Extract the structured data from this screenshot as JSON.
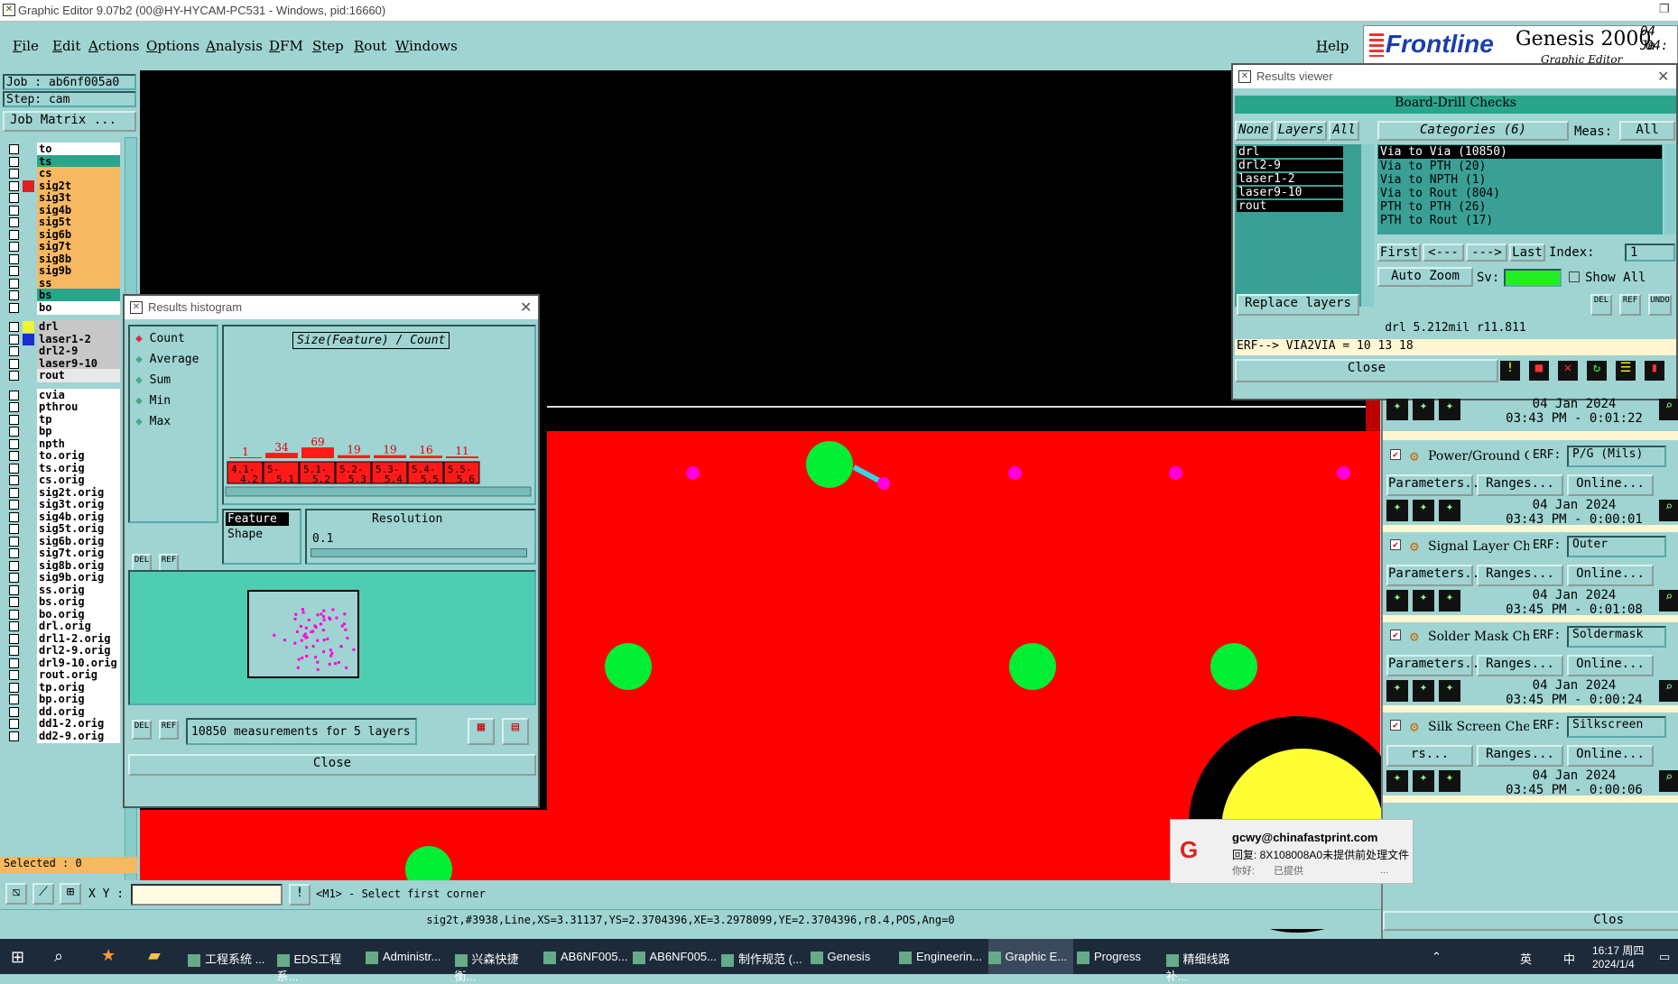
{
  "titlebar": {
    "title": "Graphic Editor 9.07b2 (00@HY-HYCAM-PC531 - Windows, pid:16660)"
  },
  "menu": {
    "items": [
      "File",
      "Edit",
      "Actions",
      "Options",
      "Analysis",
      "DFM",
      "Step",
      "Rout",
      "Windows"
    ],
    "help": "Help"
  },
  "brand": {
    "logo": "Frontline",
    "product": "Genesis 2000",
    "subtitle": "Graphic Editor",
    "date1": "04 Ja",
    "date2": "04:"
  },
  "job": {
    "job": "Job : ab6nf005a0",
    "step": "Step: cam",
    "matrix": "Job Matrix ..."
  },
  "layers": [
    {
      "name": "to",
      "color": "#ffffff"
    },
    {
      "name": "ts",
      "color": "#2aa58c"
    },
    {
      "name": "cs",
      "color": "#f6b860"
    },
    {
      "name": "sig2t",
      "color": "#f6b860",
      "swatch": "#e02020"
    },
    {
      "name": "sig3t",
      "color": "#f6b860"
    },
    {
      "name": "sig4b",
      "color": "#f6b860"
    },
    {
      "name": "sig5t",
      "color": "#f6b860"
    },
    {
      "name": "sig6b",
      "color": "#f6b860"
    },
    {
      "name": "sig7t",
      "color": "#f6b860"
    },
    {
      "name": "sig8b",
      "color": "#f6b860"
    },
    {
      "name": "sig9b",
      "color": "#f6b860"
    },
    {
      "name": "ss",
      "color": "#f6b860"
    },
    {
      "name": "bs",
      "color": "#2aa58c"
    },
    {
      "name": "bo",
      "color": "#ffffff"
    },
    {
      "name": "drl",
      "color": "#c8c8c8",
      "swatch": "#f2f23a"
    },
    {
      "name": "laser1-2",
      "color": "#c8c8c8",
      "swatch": "#1d2bd0"
    },
    {
      "name": "drl2-9",
      "color": "#c8c8c8"
    },
    {
      "name": "laser9-10",
      "color": "#c8c8c8"
    },
    {
      "name": "rout",
      "color": "#e8e8e8"
    },
    {
      "name": "cvia",
      "color": "#ffffff"
    },
    {
      "name": "pthrou",
      "color": "#ffffff"
    },
    {
      "name": "tp",
      "color": "#ffffff"
    },
    {
      "name": "bp",
      "color": "#ffffff"
    },
    {
      "name": "npth",
      "color": "#ffffff"
    },
    {
      "name": "to.orig",
      "color": "#ffffff"
    },
    {
      "name": "ts.orig",
      "color": "#ffffff"
    },
    {
      "name": "cs.orig",
      "color": "#ffffff"
    },
    {
      "name": "sig2t.orig",
      "color": "#ffffff"
    },
    {
      "name": "sig3t.orig",
      "color": "#ffffff"
    },
    {
      "name": "sig4b.orig",
      "color": "#ffffff"
    },
    {
      "name": "sig5t.orig",
      "color": "#ffffff"
    },
    {
      "name": "sig6b.orig",
      "color": "#ffffff"
    },
    {
      "name": "sig7t.orig",
      "color": "#ffffff"
    },
    {
      "name": "sig8b.orig",
      "color": "#ffffff"
    },
    {
      "name": "sig9b.orig",
      "color": "#ffffff"
    },
    {
      "name": "ss.orig",
      "color": "#ffffff"
    },
    {
      "name": "bs.orig",
      "color": "#ffffff"
    },
    {
      "name": "bo.orig",
      "color": "#ffffff"
    },
    {
      "name": "drl.orig",
      "color": "#ffffff"
    },
    {
      "name": "drl1-2.orig",
      "color": "#ffffff"
    },
    {
      "name": "drl2-9.orig",
      "color": "#ffffff"
    },
    {
      "name": "drl9-10.orig",
      "color": "#ffffff"
    },
    {
      "name": "rout.orig",
      "color": "#ffffff"
    },
    {
      "name": "tp.orig",
      "color": "#ffffff"
    },
    {
      "name": "bp.orig",
      "color": "#ffffff"
    },
    {
      "name": "dd.orig",
      "color": "#ffffff"
    },
    {
      "name": "dd1-2.orig",
      "color": "#ffffff"
    },
    {
      "name": "dd2-9.orig",
      "color": "#ffffff"
    }
  ],
  "selected": "Selected : 0",
  "command": {
    "xy_label": "X Y :",
    "prompt": "<M1> - Select first corner"
  },
  "status": "sig2t,#3938,Line,XS=3.31137,YS=2.3704396,XE=3.2978099,YE=2.3704396,r8.4,POS,Ang=0",
  "histogram": {
    "title": "Results histogram",
    "modes": [
      "Count",
      "Average",
      "Sum",
      "Min",
      "Max"
    ],
    "selected_mode": "Count",
    "chart_title": "Size(Feature) / Count",
    "counts": [
      "1",
      "34",
      "69",
      "19",
      "19",
      "16",
      "11"
    ],
    "bins": [
      "4.1-\n4.2",
      "5-\n5.1",
      "5.1-\n5.2",
      "5.2-\n5.3",
      "5.3-\n5.4",
      "5.4-\n5.5",
      "5.5-\n5.6"
    ],
    "feature_label": "Feature",
    "shape_label": "Shape",
    "resolution_label": "Resolution",
    "resolution_value": "0.1",
    "measurements": "10850 measurements for 5 layers",
    "close": "Close",
    "del": "DEL",
    "ref": "REF"
  },
  "results": {
    "title": "Results viewer",
    "header": "Board-Drill Checks",
    "none": "None",
    "layers_btn": "Layers",
    "all": "All",
    "categories_btn": "Categories (6)",
    "meas_label": "Meas:",
    "meas_value": "All",
    "layers": [
      "drl",
      "drl2-9",
      "laser1-2",
      "laser9-10",
      "rout"
    ],
    "categories": [
      "Via to Via  (10850)",
      "Via to PTH  (20)",
      "Via to NPTH  (1)",
      "Via to Rout  (804)",
      "PTH to PTH  (26)",
      "PTH to Rout  (17)"
    ],
    "first": "First",
    "prev": "<---",
    "next": "--->",
    "last": "Last",
    "index_label": "Index:",
    "index_value": "1",
    "auto_zoom": "Auto Zoom",
    "sv": "Sv:",
    "show_all": "Show All",
    "replace_layers": "Replace layers",
    "info": "drl 5.212mil  r11.811",
    "erf": "ERF--> VIA2VIA = 10 13 18",
    "close": "Close",
    "del": "DEL",
    "ref": "REF",
    "undo": "UNDO"
  },
  "checks": [
    {
      "date": "04 Jan 2024",
      "time": "03:43 PM - 0:01:22"
    },
    {
      "title": "Power/Ground C",
      "erf": "ERF:",
      "erf_value": "P/G (Mils)",
      "params": "Parameters...",
      "ranges": "Ranges...",
      "online": "Online...",
      "date": "04 Jan 2024",
      "time": "03:43 PM - 0:00:01"
    },
    {
      "title": "Signal Layer Ch",
      "erf": "ERF:",
      "erf_value": "Outer",
      "params": "Parameters...",
      "ranges": "Ranges...",
      "online": "Online...",
      "date": "04 Jan 2024",
      "time": "03:45 PM - 0:01:08"
    },
    {
      "title": "Solder Mask Ch",
      "erf": "ERF:",
      "erf_value": "Soldermask",
      "params": "Parameters...",
      "ranges": "Ranges...",
      "online": "Online...",
      "date": "04 Jan 2024",
      "time": "03:45 PM - 0:00:24"
    },
    {
      "title": "Silk Screen Che",
      "erf": "ERF:",
      "erf_value": "Silkscreen",
      "params": "rs...",
      "ranges": "Ranges...",
      "online": "Online...",
      "date": "04 Jan 2024",
      "time": "03:45 PM - 0:00:06"
    }
  ],
  "checks_close": "Clos",
  "notification": {
    "sender": "gcwy@chinafastprint.com",
    "line1": "回复: 8X108008A0未提供前处理文件",
    "line2": "你好:",
    "line3": "已提供",
    "more": "..."
  },
  "taskbar": {
    "apps": [
      "工程系统 ...",
      "EDS工程系...",
      "Administr...",
      "兴森快捷衡...",
      "AB6NF005...",
      "AB6NF005...",
      "制作规范 (...",
      "Genesis",
      "Engineerin...",
      "Graphic E...",
      "Progress",
      "精细线路补..."
    ],
    "ime": "中",
    "lang": "英",
    "time": "16:17 周四",
    "date": "2024/1/4"
  },
  "colors": {
    "bg": "#9fd4d2",
    "board": "#ff0000",
    "pad": "#00ee33",
    "via": "#ff00dd",
    "drill": "#ffff33"
  }
}
